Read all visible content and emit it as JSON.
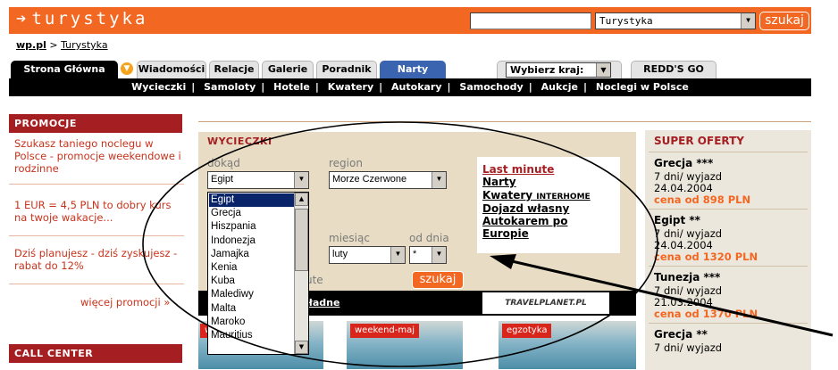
{
  "header": {
    "logo": "turystyka",
    "search_select": "Turystyka",
    "search_button": "szukaj"
  },
  "breadcrumb": {
    "home": "wp.pl",
    "separator": ">",
    "current": "Turystyka"
  },
  "tabs": [
    {
      "label": "Strona Główna"
    },
    {
      "label": "Wiadomości"
    },
    {
      "label": "Relacje"
    },
    {
      "label": "Galerie"
    },
    {
      "label": "Poradnik"
    },
    {
      "label": "Narty"
    },
    {
      "label": "Wybierz kraj:"
    },
    {
      "label": "REDD'S GO"
    }
  ],
  "subnav": [
    "Wycieczki",
    "Samoloty",
    "Hotele",
    "Kwatery",
    "Autokary",
    "Samochody",
    "Aukcje",
    "Noclegi w Polsce"
  ],
  "left": {
    "promo_title": "PROMOCJE",
    "promos": [
      "Szukasz taniego noclegu w Polsce - promocje weekendowe i rodzinne",
      "1 EUR = 4,5 PLN to dobry kurs na twoje wakacje...",
      "Dziś planujesz - dziś zyskujesz - rabat do 12%"
    ],
    "more": "więcej promocji »",
    "call_title": "CALL CENTER"
  },
  "wycieczki": {
    "title": "WYCIECZKI",
    "dokad_label": "dokąd",
    "dokad_value": "Egipt",
    "region_label": "region",
    "region_value": "Morze Czerwone",
    "miesiac_label": "miesiąc",
    "miesiac_value": "luty",
    "od_dnia_label": "od dnia",
    "od_dnia_value": "*",
    "ute_text": "ute",
    "search_button": "szukaj",
    "links": [
      "Last minute",
      "Narty",
      "Kwatery",
      "Dojazd własny",
      "Autokarem po",
      "Europie"
    ],
    "interhome": "INTERHOME",
    "dokladne": "dokładne",
    "travelplanet": "TRAVELPLANET.PL",
    "tags": [
      "weekend-maj",
      "egzotyka"
    ],
    "destinations": [
      "Egipt",
      "Grecja",
      "Hiszpania",
      "Indonezja",
      "Jamajka",
      "Kenia",
      "Kuba",
      "Malediwy",
      "Malta",
      "Maroko",
      "Mauritius"
    ]
  },
  "super_oferty": {
    "title": "SUPER OFERTY",
    "offers": [
      {
        "name": "Grecja ***",
        "duration": "7 dni/ wyjazd",
        "date": "24.04.2004",
        "price": "cena od 898 PLN"
      },
      {
        "name": "Egipt **",
        "duration": "7 dni/ wyjazd",
        "date": "24.04.2004",
        "price": "cena od 1320 PLN"
      },
      {
        "name": "Tunezja ***",
        "duration": "7 dni/ wyjazd",
        "date": "21.03.2004",
        "price": "cena od 1370 PLN"
      },
      {
        "name": "Grecja **",
        "duration": "7 dni/ wyjazd",
        "date": "",
        "price": ""
      }
    ]
  },
  "colors": {
    "brand_orange": "#f26722",
    "dark_red": "#a41e22",
    "link_red": "#c7331c"
  }
}
